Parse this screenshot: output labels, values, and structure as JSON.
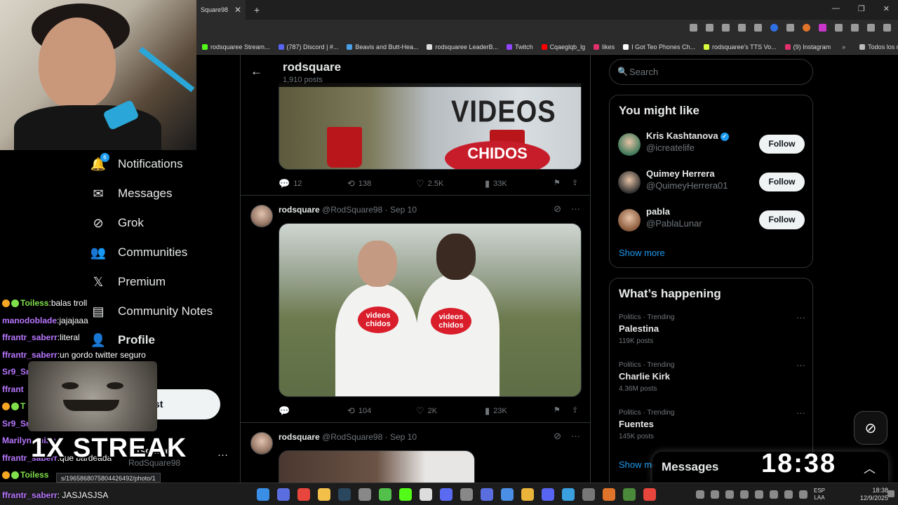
{
  "browser": {
    "tab_title": "Square98",
    "tab_close": "✕",
    "new_tab": "+",
    "window_controls": [
      "—",
      "❐",
      "✕"
    ],
    "bookmarks": [
      {
        "label": "rodsquaree Stream...",
        "color": "#53fc18"
      },
      {
        "label": "(787) Discord | #...",
        "color": "#5865f2"
      },
      {
        "label": "Beavis and Butt-Hea...",
        "color": "#4aa0e6"
      },
      {
        "label": "rodsquaree LeaderB...",
        "color": "#dddddd"
      },
      {
        "label": "Twitch",
        "color": "#9146ff"
      },
      {
        "label": "Cqaeglqb_lg",
        "color": "#ff0000"
      },
      {
        "label": "likes",
        "color": "#e1306c"
      },
      {
        "label": "I Got Teo Phones Ch...",
        "color": "#ffffff"
      },
      {
        "label": "rodsquaree's TTS Vo...",
        "color": "#d7ff3c"
      },
      {
        "label": "(9) Instagram",
        "color": "#e1306c"
      }
    ],
    "bookmarks_more": "»",
    "bookmarks_folder": "Todos los marcadores"
  },
  "nav": {
    "notifications_badge": "6",
    "items": [
      {
        "label": "Notifications",
        "icon": "bell-icon",
        "glyph": "🔔"
      },
      {
        "label": "Messages",
        "icon": "envelope-icon",
        "glyph": "✉"
      },
      {
        "label": "Grok",
        "icon": "grok-icon",
        "glyph": "⊘"
      },
      {
        "label": "Communities",
        "icon": "communities-icon",
        "glyph": "👥"
      },
      {
        "label": "Premium",
        "icon": "x-logo-icon",
        "glyph": "𝕏"
      },
      {
        "label": "Community Notes",
        "icon": "community-notes-icon",
        "glyph": "▤"
      },
      {
        "label": "Profile",
        "icon": "person-icon",
        "glyph": "👤"
      }
    ],
    "post_button": "st",
    "account_name": "rsquare",
    "account_handle": "RodSquare98",
    "account_more": "···"
  },
  "chat": [
    {
      "user": "Toiless",
      "msg": "balas troll",
      "color": "green",
      "badges": true
    },
    {
      "user": "manodoblade",
      "msg": "jajajaaa",
      "color": "purple",
      "badges": false
    },
    {
      "user": "ffrantr_saberr",
      "msg": "literal",
      "color": "purple",
      "badges": false
    },
    {
      "user": "ffrantr_saberr",
      "msg": "un gordo twitter seguro",
      "color": "purple",
      "badges": false
    },
    {
      "user": "Sr9_Sr",
      "msg": "",
      "color": "purple",
      "badges": false
    },
    {
      "user": "ffrant",
      "msg": "",
      "color": "purple",
      "badges": false
    },
    {
      "user": "T",
      "msg": "",
      "color": "green",
      "badges": true
    },
    {
      "user": "Sr9_Sr",
      "msg": "",
      "color": "purple",
      "badges": false
    },
    {
      "user": "Marilyn_miau",
      "msg": "",
      "color": "purple",
      "badges": false
    },
    {
      "user": "ffrantr_saberr",
      "msg": "que bardeada",
      "color": "purple",
      "badges": false
    },
    {
      "user": "Toiless",
      "msg": "",
      "color": "green",
      "badges": true
    }
  ],
  "chat_last": {
    "user": "ffrantr_saberr",
    "msg": "JASJASJSA"
  },
  "streak_text": "1X STREAK",
  "status_url": "s/1965868075804426492/photo/1",
  "timeline": {
    "header_title": "rodsquare",
    "header_count": "1,910 posts",
    "media_text": "VIDEOS",
    "media_text2": "CHIDOS",
    "shirt_text": "videos chidos",
    "posts": [
      {
        "name": "rodsquare",
        "handle": "@RodSquare98",
        "sep": "·",
        "date": "Sep 10",
        "stats": {
          "replies": "12",
          "reposts": "138",
          "likes": "2.5K",
          "views": "33K"
        }
      },
      {
        "name": "rodsquare",
        "handle": "@RodSquare98",
        "sep": "·",
        "date": "Sep 10",
        "stats": {
          "replies": "",
          "reposts": "104",
          "likes": "2K",
          "views": "23K"
        }
      },
      {
        "name": "rodsquare",
        "handle": "@RodSquare98",
        "sep": "·",
        "date": "Sep 10"
      }
    ]
  },
  "sidebar": {
    "search_placeholder": "Search",
    "might_like_title": "You might like",
    "suggestions": [
      {
        "name": "Kris Kashtanova",
        "handle": "@icreatelife",
        "verified": true,
        "color": "#3f7a5a"
      },
      {
        "name": "Quimey Herrera",
        "handle": "@QuimeyHerrera01",
        "verified": false,
        "color": "#333333"
      },
      {
        "name": "pabla",
        "handle": "@PablaLunar",
        "verified": false,
        "color": "#8a5a3c"
      }
    ],
    "follow_label": "Follow",
    "show_more": "Show more",
    "happening_title": "What’s happening",
    "trends": [
      {
        "category": "Politics · Trending",
        "name": "Palestina",
        "count": "119K posts"
      },
      {
        "category": "Politics · Trending",
        "name": "Charlie Kirk",
        "count": "4.36M posts"
      },
      {
        "category": "Politics · Trending",
        "name": "Fuentes",
        "count": "145K posts"
      }
    ],
    "show_more_partial": "Show me",
    "messages_title": "Messages",
    "clock_overlay": "18:38"
  },
  "taskbar": {
    "icon_colors": [
      "#3a8ee6",
      "#5b6ee0",
      "#e8453c",
      "#f2c04a",
      "#2a475e",
      "#888888",
      "#52c04a",
      "#53fc18",
      "#dddddd",
      "#5a6bf2",
      "#888888",
      "#5b6ee0",
      "#4a8ee6",
      "#eab33a",
      "#5865f2",
      "#3aa0e0",
      "#777777",
      "#e0742a",
      "#4a8a3a",
      "#e8453c"
    ],
    "lang_top": "ESP",
    "lang_bottom": "LAA",
    "time": "18:38",
    "date": "12/9/2025"
  }
}
